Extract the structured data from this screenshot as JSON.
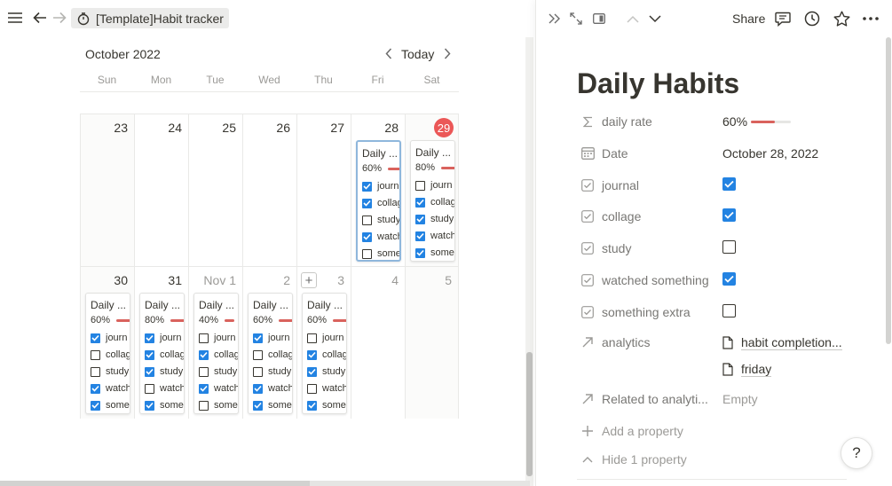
{
  "topbar": {
    "breadcrumb": "[Template]Habit tracker",
    "icons": [
      "menu-icon",
      "back-arrow-icon",
      "forward-arrow-icon",
      "stopwatch-icon"
    ]
  },
  "calendar": {
    "month": "October 2022",
    "today_label": "Today",
    "weekdays": [
      "Sun",
      "Mon",
      "Tue",
      "Wed",
      "Thu",
      "Fri",
      "Sat"
    ],
    "weeks": [
      {
        "days": [
          {
            "label": "23"
          },
          {
            "label": "24"
          },
          {
            "label": "25"
          },
          {
            "label": "26"
          },
          {
            "label": "27"
          },
          {
            "label": "28",
            "card": {
              "title": "Daily ...",
              "pct": "60%",
              "rate": 0.6,
              "selected": true,
              "items": [
                {
                  "t": "journ",
                  "c": true
                },
                {
                  "t": "collag",
                  "c": true
                },
                {
                  "t": "study",
                  "c": false
                },
                {
                  "t": "watch",
                  "c": true
                },
                {
                  "t": "some",
                  "c": false
                }
              ]
            }
          },
          {
            "label": "29",
            "today": true,
            "card": {
              "title": "Daily ...",
              "pct": "80%",
              "rate": 0.8,
              "items": [
                {
                  "t": "journ",
                  "c": false
                },
                {
                  "t": "collag",
                  "c": true
                },
                {
                  "t": "study",
                  "c": true
                },
                {
                  "t": "watch",
                  "c": true
                },
                {
                  "t": "some",
                  "c": true
                }
              ]
            }
          }
        ]
      },
      {
        "days": [
          {
            "label": "30",
            "card": {
              "title": "Daily ...",
              "pct": "60%",
              "rate": 0.6,
              "items": [
                {
                  "t": "journ",
                  "c": true
                },
                {
                  "t": "collag",
                  "c": false
                },
                {
                  "t": "study",
                  "c": false
                },
                {
                  "t": "watch",
                  "c": true
                },
                {
                  "t": "some",
                  "c": true
                }
              ]
            }
          },
          {
            "label": "31",
            "card": {
              "title": "Daily ...",
              "pct": "80%",
              "rate": 0.8,
              "items": [
                {
                  "t": "journ",
                  "c": true
                },
                {
                  "t": "collag",
                  "c": true
                },
                {
                  "t": "study",
                  "c": true
                },
                {
                  "t": "watch",
                  "c": false
                },
                {
                  "t": "some",
                  "c": true
                }
              ]
            }
          },
          {
            "label": "Nov 1",
            "muted": true,
            "card": {
              "title": "Daily ...",
              "pct": "40%",
              "rate": 0.4,
              "items": [
                {
                  "t": "journ",
                  "c": false
                },
                {
                  "t": "collag",
                  "c": true
                },
                {
                  "t": "study",
                  "c": false
                },
                {
                  "t": "watch",
                  "c": true
                },
                {
                  "t": "some",
                  "c": false
                }
              ]
            }
          },
          {
            "label": "2",
            "muted": true,
            "card": {
              "title": "Daily ...",
              "pct": "60%",
              "rate": 0.6,
              "items": [
                {
                  "t": "journ",
                  "c": true
                },
                {
                  "t": "collag",
                  "c": false
                },
                {
                  "t": "study",
                  "c": false
                },
                {
                  "t": "watch",
                  "c": true
                },
                {
                  "t": "some",
                  "c": true
                }
              ]
            }
          },
          {
            "label": "3",
            "muted": true,
            "add_button": "+",
            "card": {
              "title": "Daily ...",
              "pct": "60%",
              "rate": 0.6,
              "items": [
                {
                  "t": "journ",
                  "c": false
                },
                {
                  "t": "collag",
                  "c": true
                },
                {
                  "t": "study",
                  "c": true
                },
                {
                  "t": "watch",
                  "c": false
                },
                {
                  "t": "some",
                  "c": true
                }
              ]
            }
          },
          {
            "label": "4",
            "muted": true
          },
          {
            "label": "5",
            "muted": true
          }
        ]
      }
    ]
  },
  "peek": {
    "share_label": "Share",
    "title": "Daily Habits",
    "properties": [
      {
        "icon": "sigma-icon",
        "name": "daily rate",
        "type": "rate",
        "value": "60%",
        "rate": 0.6
      },
      {
        "icon": "calendar-icon",
        "name": "Date",
        "type": "text",
        "value": "October 28, 2022"
      },
      {
        "icon": "checkbox-icon",
        "name": "journal",
        "type": "checkbox",
        "checked": true
      },
      {
        "icon": "checkbox-icon",
        "name": "collage",
        "type": "checkbox",
        "checked": true
      },
      {
        "icon": "checkbox-icon",
        "name": "study",
        "type": "checkbox",
        "checked": false
      },
      {
        "icon": "checkbox-icon",
        "name": "watched something",
        "type": "checkbox",
        "checked": true
      },
      {
        "icon": "checkbox-icon",
        "name": "something extra",
        "type": "checkbox",
        "checked": false
      }
    ],
    "analytics": {
      "name": "analytics",
      "items": [
        "habit completion...",
        "friday"
      ]
    },
    "related": {
      "name": "Related to analyti...",
      "value": "Empty"
    },
    "add_property": "Add a property",
    "hide_property": "Hide 1 property",
    "help": "?"
  },
  "colors": {
    "accent": "#2383e2",
    "bar": "#d9625d",
    "today": "#eb5757"
  }
}
